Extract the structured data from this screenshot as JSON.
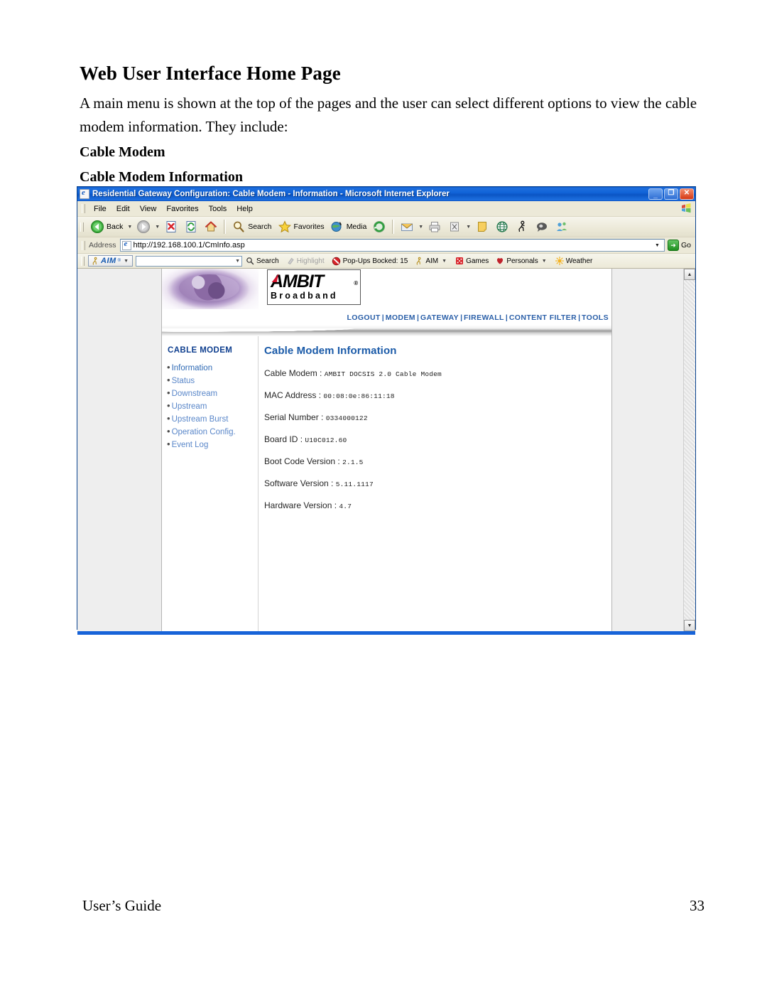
{
  "document": {
    "heading": "Web User Interface Home Page",
    "paragraph": "A main menu is shown at the top of the pages and the user can select different options to view the cable modem information. They include:",
    "sub_heading_1": "Cable Modem",
    "sub_heading_2": "Cable Modem Information",
    "footer_left": "User’s Guide",
    "footer_page": "33"
  },
  "browser": {
    "title": "Residential Gateway Configuration: Cable Modem - Information - Microsoft Internet Explorer",
    "window_controls": {
      "minimize": "_",
      "maximize": "❐",
      "close": "✕"
    },
    "menu": [
      "File",
      "Edit",
      "View",
      "Favorites",
      "Tools",
      "Help"
    ],
    "toolbar": {
      "back": "Back",
      "forward": "",
      "stop": "",
      "refresh": "",
      "home": "",
      "search": "Search",
      "favorites": "Favorites",
      "media": "Media",
      "history": "",
      "mail": "",
      "print": "",
      "edit": "",
      "discuss": "",
      "notes": "",
      "research": "",
      "messenger": "",
      "realplayer": "",
      "people": ""
    },
    "address": {
      "label": "Address",
      "url": "http://192.168.100.1/CmInfo.asp",
      "go": "Go"
    },
    "aim_toolbar": {
      "brand": "AIM",
      "registered": "®",
      "search_value": "",
      "search": "Search",
      "highlight": "Highlight",
      "popups": "Pop-Ups Bocked: 15",
      "aim": "AIM",
      "games": "Games",
      "personals": "Personals",
      "weather": "Weather"
    }
  },
  "page": {
    "logo": {
      "brand": "AMBIT",
      "registered": "®",
      "tagline": "Broadband"
    },
    "nav": [
      "LOGOUT",
      "MODEM",
      "GATEWAY",
      "FIREWALL",
      "CONTENT FILTER",
      "TOOLS"
    ],
    "nav_separator": "|",
    "sidebar": {
      "title": "CABLE MODEM",
      "items": [
        {
          "label": "Information",
          "active": true
        },
        {
          "label": "Status",
          "active": false
        },
        {
          "label": "Downstream",
          "active": false
        },
        {
          "label": "Upstream",
          "active": false
        },
        {
          "label": "Upstream Burst",
          "active": false
        },
        {
          "label": "Operation Config.",
          "active": false
        },
        {
          "label": "Event Log",
          "active": false
        }
      ]
    },
    "main": {
      "title": "Cable Modem Information",
      "rows": [
        {
          "label": "Cable Modem :",
          "value": "AMBIT DOCSIS 2.0 Cable Modem"
        },
        {
          "label": "MAC Address :",
          "value": "00:08:0e:86:11:18"
        },
        {
          "label": "Serial Number :",
          "value": "0334000122"
        },
        {
          "label": "Board ID :",
          "value": "U10C012.60"
        },
        {
          "label": "Boot Code Version :",
          "value": "2.1.5"
        },
        {
          "label": "Software Version :",
          "value": "5.11.1117"
        },
        {
          "label": "Hardware Version :",
          "value": "4.7"
        }
      ]
    }
  },
  "colors": {
    "titlebar_blue": "#0b55c4",
    "link_blue": "#5a87c9",
    "nav_blue": "#2a5fa8",
    "heading_blue": "#1a5aa8",
    "ambit_red": "#d2102a",
    "footer_blue": "#1763d8"
  }
}
